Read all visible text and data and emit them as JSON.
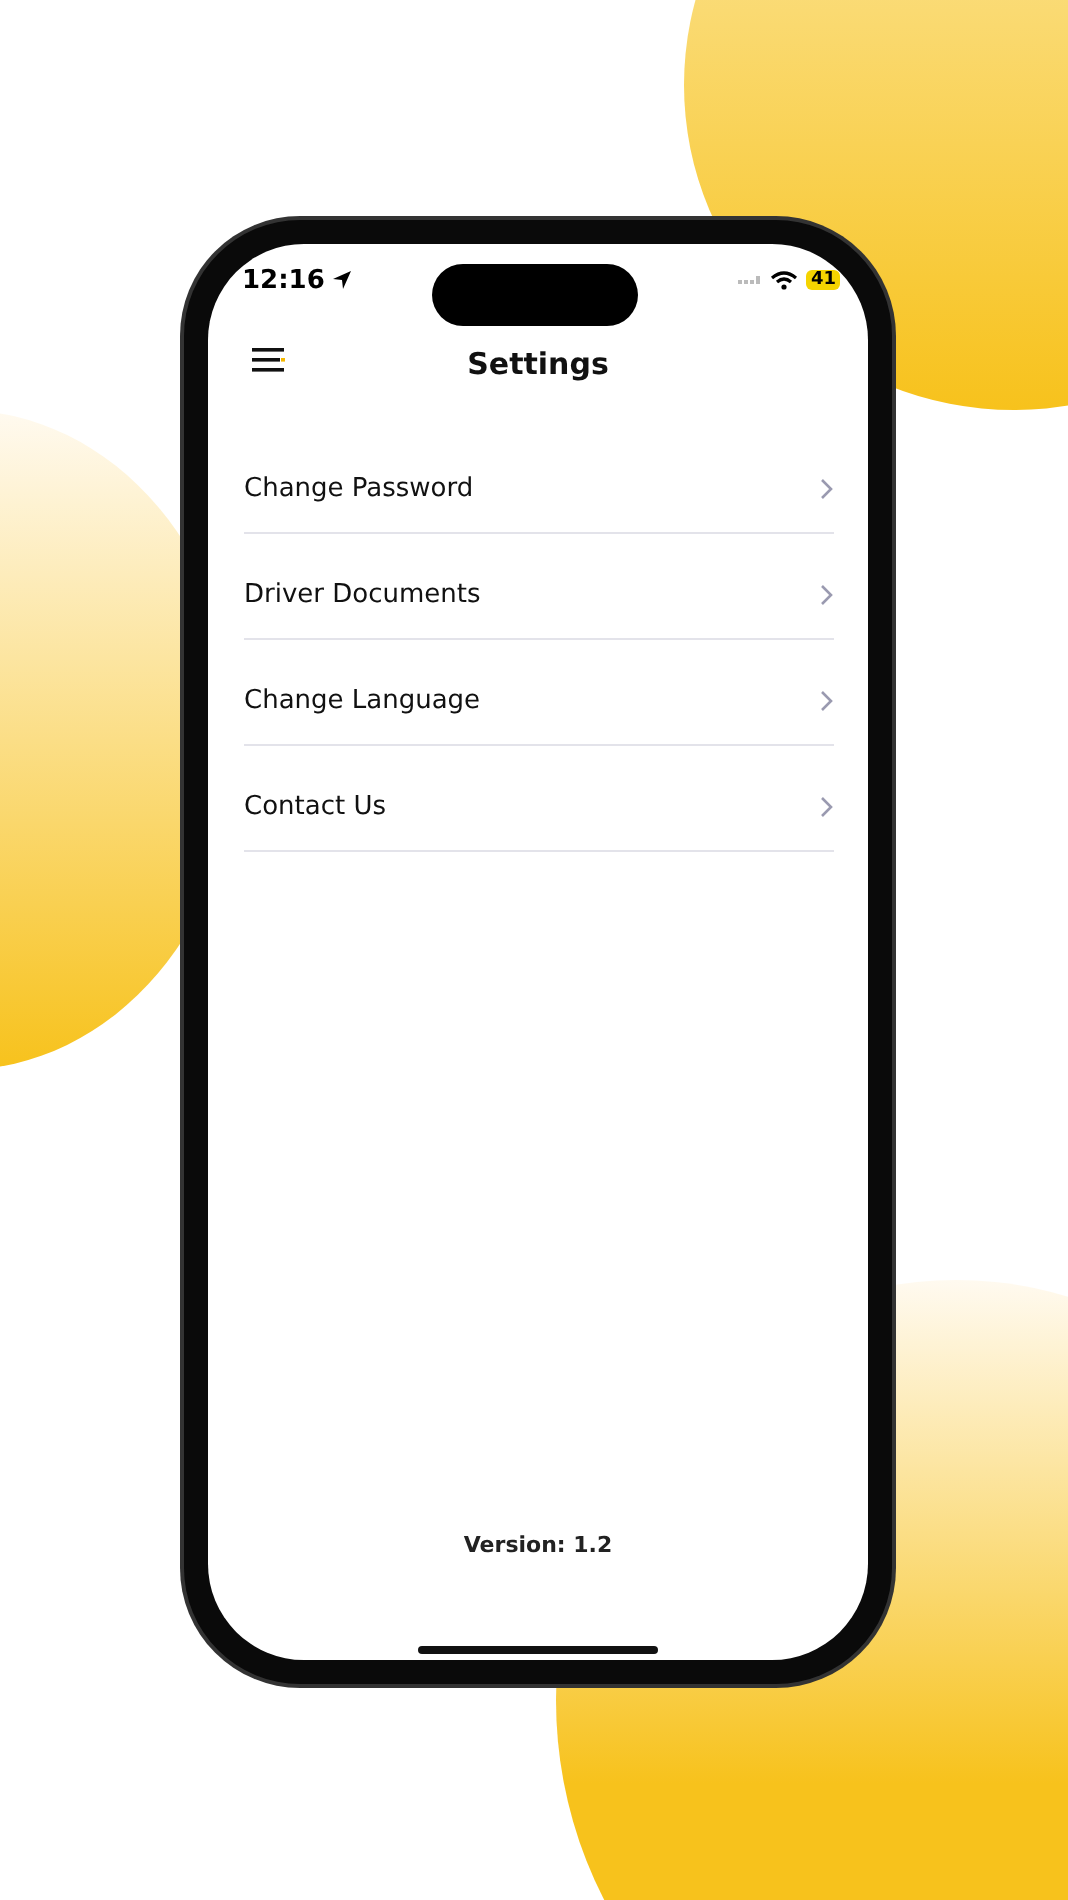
{
  "status_bar": {
    "time": "12:16",
    "battery": "41"
  },
  "header": {
    "title": "Settings"
  },
  "menu_items": [
    {
      "label": "Change Password"
    },
    {
      "label": "Driver Documents"
    },
    {
      "label": "Change Language"
    },
    {
      "label": "Contact Us"
    }
  ],
  "footer": {
    "version": "Version: 1.2"
  }
}
